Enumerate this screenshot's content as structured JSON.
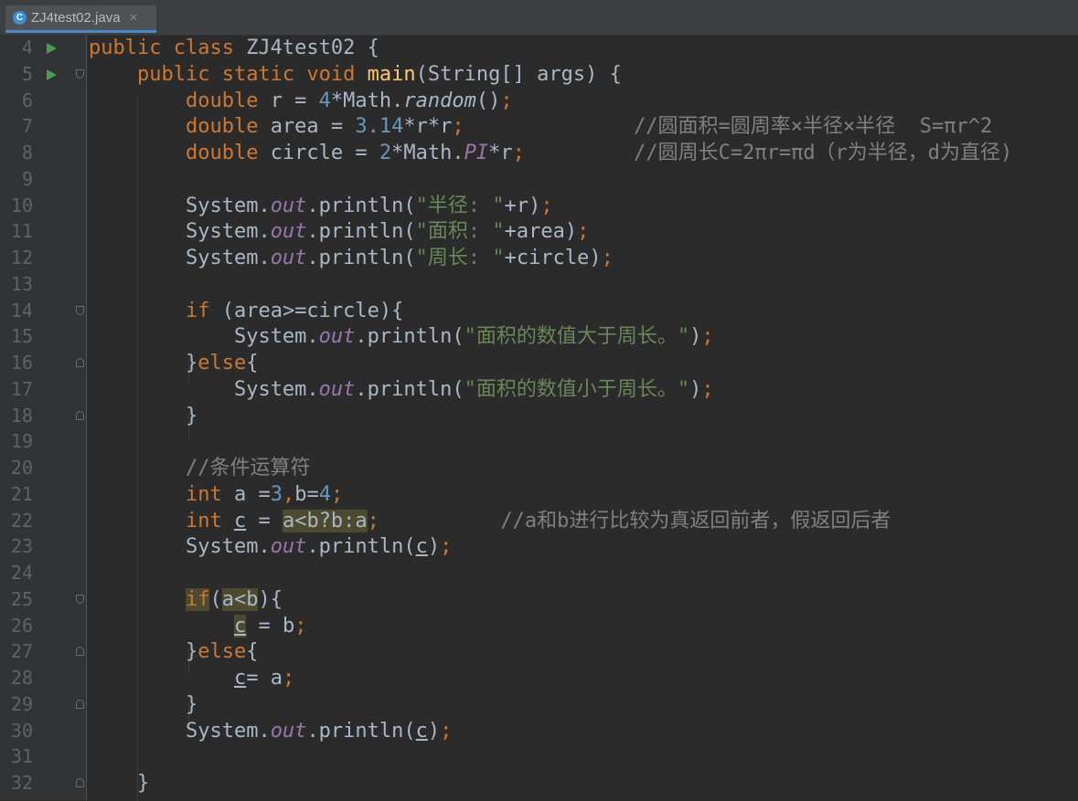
{
  "tab": {
    "title": "ZJ4test02.java",
    "icon": "java-class-icon",
    "icon_glyph": "C",
    "close": "×"
  },
  "lines": [
    {
      "n": "4",
      "run": true,
      "tokens": [
        [
          "public class ",
          "kw"
        ],
        [
          "ZJ4test02 {",
          ""
        ]
      ]
    },
    {
      "n": "5",
      "run": true,
      "fold": "open",
      "tokens": [
        [
          "    ",
          ""
        ],
        [
          "public static void ",
          "kw"
        ],
        [
          "main",
          "fn"
        ],
        [
          "(String[] args) {",
          ""
        ]
      ]
    },
    {
      "n": "6",
      "tokens": [
        [
          "        ",
          ""
        ],
        [
          "double ",
          "kw"
        ],
        [
          "r = ",
          ""
        ],
        [
          "4",
          "num"
        ],
        [
          "*Math.",
          ""
        ],
        [
          "random",
          "it"
        ],
        [
          "()",
          ""
        ],
        [
          ";",
          "kw"
        ]
      ]
    },
    {
      "n": "7",
      "tokens": [
        [
          "        ",
          ""
        ],
        [
          "double ",
          "kw"
        ],
        [
          "area = ",
          ""
        ],
        [
          "3.14",
          "num"
        ],
        [
          "*r*r",
          ""
        ],
        [
          ";",
          "kw"
        ],
        [
          "              ",
          ""
        ],
        [
          "//圆面积=圆周率×半径×半径  S=πr^2",
          "cmt"
        ]
      ]
    },
    {
      "n": "8",
      "tokens": [
        [
          "        ",
          ""
        ],
        [
          "double ",
          "kw"
        ],
        [
          "circle = ",
          ""
        ],
        [
          "2",
          "num"
        ],
        [
          "*Math.",
          ""
        ],
        [
          "PI",
          "fld"
        ],
        [
          "*r",
          ""
        ],
        [
          ";",
          "kw"
        ],
        [
          "         ",
          ""
        ],
        [
          "//圆周长C=2πr=πd（r为半径，d为直径)",
          "cmt"
        ]
      ]
    },
    {
      "n": "9",
      "tokens": []
    },
    {
      "n": "10",
      "tokens": [
        [
          "        ",
          ""
        ],
        [
          "System.",
          ""
        ],
        [
          "out",
          "fld"
        ],
        [
          ".println(",
          ""
        ],
        [
          "\"半径: \"",
          "str"
        ],
        [
          "+r)",
          ""
        ],
        [
          ";",
          "kw"
        ]
      ]
    },
    {
      "n": "11",
      "tokens": [
        [
          "        ",
          ""
        ],
        [
          "System.",
          ""
        ],
        [
          "out",
          "fld"
        ],
        [
          ".println(",
          ""
        ],
        [
          "\"面积: \"",
          "str"
        ],
        [
          "+area)",
          ""
        ],
        [
          ";",
          "kw"
        ]
      ]
    },
    {
      "n": "12",
      "tokens": [
        [
          "        ",
          ""
        ],
        [
          "System.",
          ""
        ],
        [
          "out",
          "fld"
        ],
        [
          ".println(",
          ""
        ],
        [
          "\"周长: \"",
          "str"
        ],
        [
          "+circle)",
          ""
        ],
        [
          ";",
          "kw"
        ]
      ]
    },
    {
      "n": "13",
      "tokens": []
    },
    {
      "n": "14",
      "fold": "open",
      "tokens": [
        [
          "        ",
          ""
        ],
        [
          "if ",
          "kw"
        ],
        [
          "(area>=circle){",
          ""
        ]
      ]
    },
    {
      "n": "15",
      "tokens": [
        [
          "            ",
          ""
        ],
        [
          "System.",
          ""
        ],
        [
          "out",
          "fld"
        ],
        [
          ".println(",
          ""
        ],
        [
          "\"面积的数值大于周长。\"",
          "str"
        ],
        [
          ")",
          ""
        ],
        [
          ";",
          "kw"
        ]
      ]
    },
    {
      "n": "16",
      "fold": "close",
      "tokens": [
        [
          "        ",
          ""
        ],
        [
          "}",
          ""
        ],
        [
          "else",
          "kw"
        ],
        [
          "{",
          ""
        ]
      ]
    },
    {
      "n": "17",
      "tokens": [
        [
          "            ",
          ""
        ],
        [
          "System.",
          ""
        ],
        [
          "out",
          "fld"
        ],
        [
          ".println(",
          ""
        ],
        [
          "\"面积的数值小于周长。\"",
          "str"
        ],
        [
          ")",
          ""
        ],
        [
          ";",
          "kw"
        ]
      ]
    },
    {
      "n": "18",
      "fold": "close",
      "tokens": [
        [
          "        ",
          ""
        ],
        [
          "}",
          ""
        ]
      ]
    },
    {
      "n": "19",
      "tokens": []
    },
    {
      "n": "20",
      "tokens": [
        [
          "        ",
          ""
        ],
        [
          "//条件运算符",
          "cmt"
        ]
      ]
    },
    {
      "n": "21",
      "tokens": [
        [
          "        ",
          ""
        ],
        [
          "int ",
          "kw"
        ],
        [
          "a =",
          ""
        ],
        [
          "3",
          "num"
        ],
        [
          ",",
          "kw"
        ],
        [
          "b=",
          ""
        ],
        [
          "4",
          "num"
        ],
        [
          ";",
          "kw"
        ]
      ]
    },
    {
      "n": "22",
      "tokens": [
        [
          "        ",
          ""
        ],
        [
          "int ",
          "kw"
        ],
        [
          "c",
          "ul"
        ],
        [
          " = ",
          ""
        ],
        [
          "a<b?b:a",
          "hl"
        ],
        [
          ";",
          "kw"
        ],
        [
          "          ",
          ""
        ],
        [
          "//a和b进行比较为真返回前者，假返回后者",
          "cmt"
        ]
      ]
    },
    {
      "n": "23",
      "tokens": [
        [
          "        ",
          ""
        ],
        [
          "System.",
          ""
        ],
        [
          "out",
          "fld"
        ],
        [
          ".println(",
          ""
        ],
        [
          "c",
          "ul"
        ],
        [
          ")",
          ""
        ],
        [
          ";",
          "kw"
        ]
      ]
    },
    {
      "n": "24",
      "tokens": []
    },
    {
      "n": "25",
      "fold": "open",
      "tokens": [
        [
          "        ",
          ""
        ],
        [
          "if",
          "kw hl"
        ],
        [
          "(",
          ""
        ],
        [
          "a<b",
          "hl"
        ],
        [
          "){",
          ""
        ]
      ]
    },
    {
      "n": "26",
      "tokens": [
        [
          "            ",
          ""
        ],
        [
          "c",
          "ul hl"
        ],
        [
          " = b",
          ""
        ],
        [
          ";",
          "kw"
        ]
      ]
    },
    {
      "n": "27",
      "fold": "close",
      "tokens": [
        [
          "        ",
          ""
        ],
        [
          "}",
          ""
        ],
        [
          "else",
          "kw"
        ],
        [
          "{",
          ""
        ]
      ]
    },
    {
      "n": "28",
      "tokens": [
        [
          "            ",
          ""
        ],
        [
          "c",
          "ul"
        ],
        [
          "= a",
          ""
        ],
        [
          ";",
          "kw"
        ]
      ]
    },
    {
      "n": "29",
      "fold": "close",
      "tokens": [
        [
          "        ",
          ""
        ],
        [
          "}",
          ""
        ]
      ]
    },
    {
      "n": "30",
      "tokens": [
        [
          "        ",
          ""
        ],
        [
          "System.",
          ""
        ],
        [
          "out",
          "fld"
        ],
        [
          ".println(",
          ""
        ],
        [
          "c",
          "ul"
        ],
        [
          ")",
          ""
        ],
        [
          ";",
          "kw"
        ]
      ]
    },
    {
      "n": "31",
      "tokens": []
    },
    {
      "n": "32",
      "fold": "close",
      "tokens": [
        [
          "    ",
          ""
        ],
        [
          "}",
          ""
        ]
      ]
    }
  ]
}
